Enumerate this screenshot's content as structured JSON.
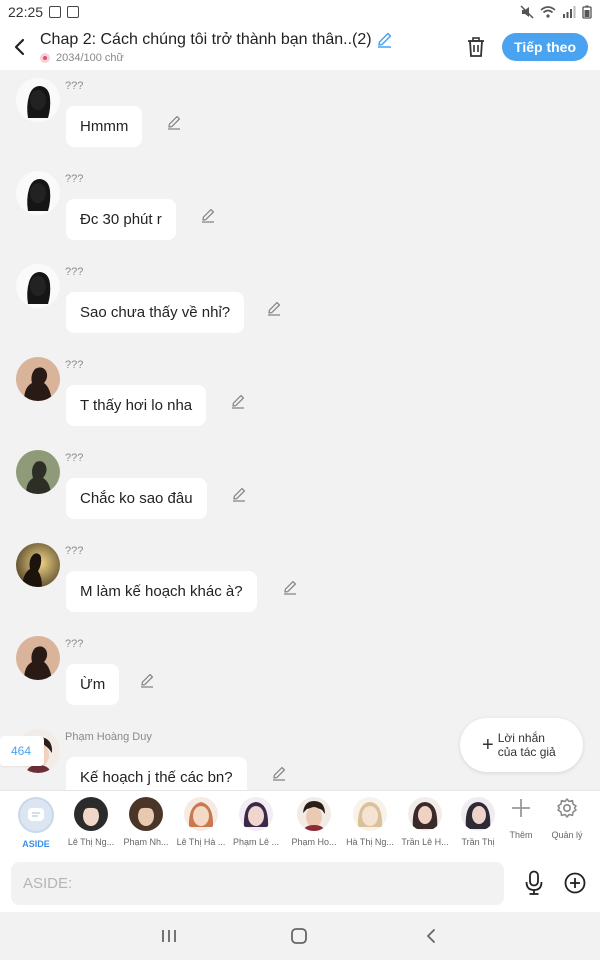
{
  "status_bar": {
    "time": "22:25"
  },
  "header": {
    "title": "Chap 2: Cách chúng tôi trở thành bạn thân..(2)",
    "word_count": "2034/100 chữ",
    "next_label": "Tiếp theo",
    "accent_color": "#4aa3f0"
  },
  "messages": [
    {
      "sender": "???",
      "text": "Hmmm",
      "avatar": "silhouette-long-hair"
    },
    {
      "sender": "???",
      "text": "Đc 30 phút r",
      "avatar": "silhouette-long-hair"
    },
    {
      "sender": "???",
      "text": "Sao chưa thấy về nhỉ?",
      "avatar": "silhouette-long-hair"
    },
    {
      "sender": "???",
      "text": "T thấy hơi lo nha",
      "avatar": "silhouette-profile-warm"
    },
    {
      "sender": "???",
      "text": "Chắc ko sao đâu",
      "avatar": "silhouette-olive"
    },
    {
      "sender": "???",
      "text": "M làm kế hoạch khác à?",
      "avatar": "silhouette-backlit"
    },
    {
      "sender": "???",
      "text": "Ừm",
      "avatar": "silhouette-profile-warm"
    },
    {
      "sender": "Phạm Hoàng Duy",
      "text": "Kế hoạch j thế các bn?",
      "avatar": "boy-dark-hair"
    }
  ],
  "message_counter": "464",
  "author_note": {
    "line1": "Lời nhắn",
    "line2": "của tác giả"
  },
  "characters": [
    {
      "label": "ASIDE",
      "active": true
    },
    {
      "label": "Lê Thị Ng...",
      "palette": [
        "#2b2b2b",
        "#f0d8c8"
      ]
    },
    {
      "label": "Phạm Nh...",
      "palette": [
        "#4a3528",
        "#e8c9b0"
      ]
    },
    {
      "label": "Lê Thị Hà ...",
      "palette": [
        "#c9784f",
        "#f4d9c6"
      ]
    },
    {
      "label": "Phạm Lê ...",
      "palette": [
        "#3a2a4a",
        "#f1d6cf"
      ]
    },
    {
      "label": "Phạm Ho...",
      "palette": [
        "#2a1e1a",
        "#ecc9b2"
      ]
    },
    {
      "label": "Hà Thị Ng...",
      "palette": [
        "#d9c29a",
        "#f6e2d3"
      ]
    },
    {
      "label": "Trần Lê H...",
      "palette": [
        "#3b2a2a",
        "#efd2c2"
      ]
    },
    {
      "label": "Trần Thị",
      "palette": [
        "#2e2a36",
        "#eed3cb"
      ]
    }
  ],
  "tools": {
    "add_label": "Thêm",
    "manage_label": "Quản lý"
  },
  "input": {
    "placeholder": "ASIDE:"
  }
}
